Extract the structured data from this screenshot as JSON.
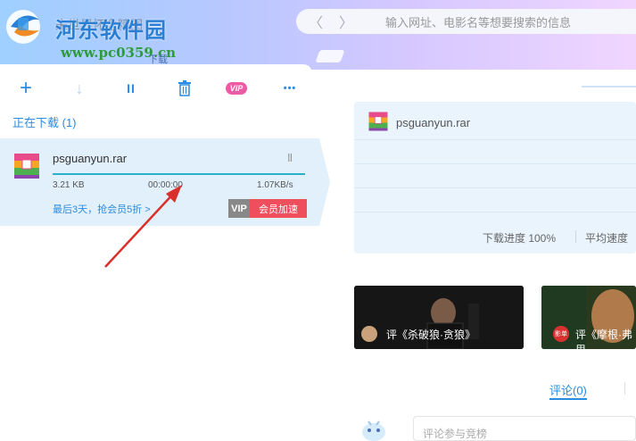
{
  "header": {
    "logo_text": "河东软件园",
    "logo_sub": "未世界怀念精图",
    "logo_url": "www.pc0359.cn",
    "section_label": "下载",
    "nav_back": "〈",
    "nav_forward": "〉",
    "search_placeholder": "输入网址、电影名等想要搜索的信息"
  },
  "toolbar": {
    "add_icon": "+",
    "download_icon": "↓",
    "pause_icon": "II",
    "delete_icon": "trash-icon",
    "vip_label": "VIP",
    "more_icon": "•••"
  },
  "list": {
    "section_title": "正在下载 (1)",
    "item": {
      "file_name": "psguanyun.rar",
      "size": "3.21 KB",
      "time": "00:00:00",
      "speed": "1.07KB/s",
      "promo": "最后3天，抢会员5折 >",
      "vip_tag": "VIP",
      "accelerate": "会员加速",
      "progress": 1.0
    }
  },
  "detail": {
    "file_name": "psguanyun.rar",
    "progress_text": "下载进度 100%",
    "avg_speed_text": "平均速度"
  },
  "cards": [
    {
      "text": "评《杀破狼·贪狼》"
    },
    {
      "text": "评《摩根·弗里",
      "badge": "影单"
    }
  ],
  "comments": {
    "tab_label": "评论(0)",
    "input_placeholder": "评论参与竞榜"
  },
  "colors": {
    "accent": "#2a8be0",
    "vip_pink": "#ee5aa3",
    "accelerate_red": "#ef4f5c",
    "progress": "#2ab0c8"
  }
}
